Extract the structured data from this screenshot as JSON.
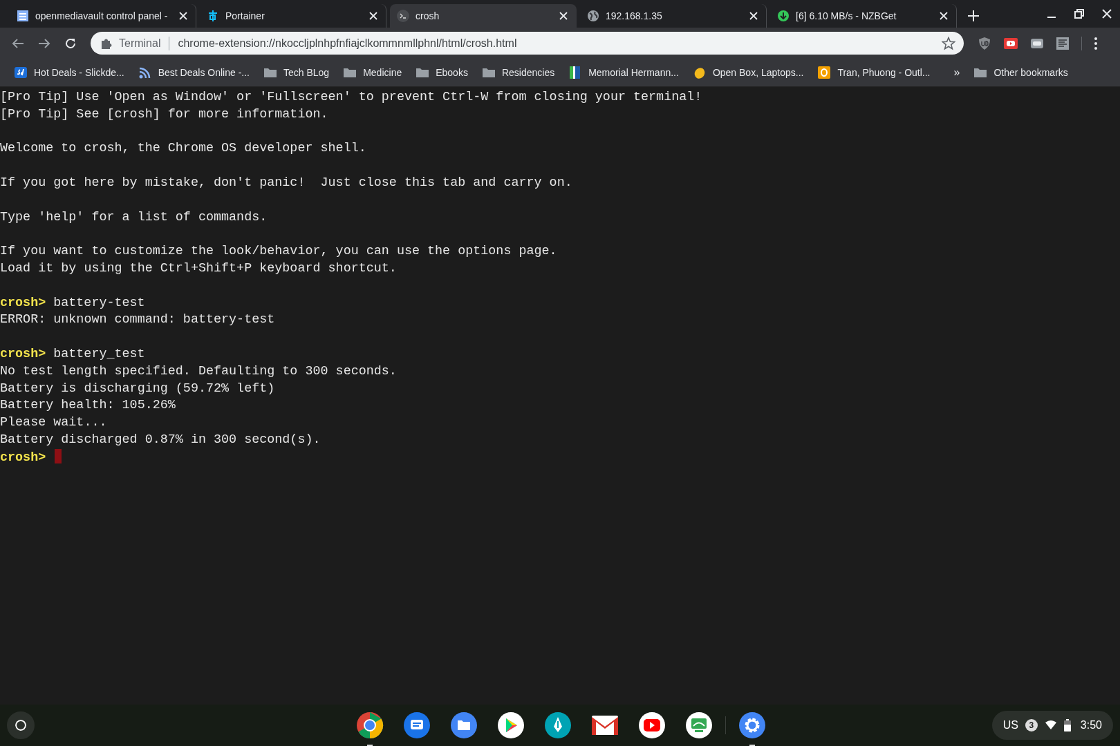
{
  "tabs": [
    {
      "title": "openmediavault control panel -",
      "selected": false
    },
    {
      "title": "Portainer",
      "selected": false
    },
    {
      "title": "crosh",
      "selected": true
    },
    {
      "title": "192.168.1.35",
      "selected": false
    },
    {
      "title": "[6] 6.10 MB/s - NZBGet",
      "selected": false
    }
  ],
  "omnibox": {
    "chip": "Terminal",
    "url": "chrome-extension://nkoccljplnhpfnfiajclkommnmllphnl/html/crosh.html"
  },
  "bookmarks": [
    {
      "title": "Hot Deals - Slickde..."
    },
    {
      "title": "Best Deals Online -..."
    },
    {
      "title": "Tech BLog"
    },
    {
      "title": "Medicine"
    },
    {
      "title": "Ebooks"
    },
    {
      "title": "Residencies"
    },
    {
      "title": "Memorial Hermann..."
    },
    {
      "title": "Open Box, Laptops..."
    },
    {
      "title": "Tran, Phuong - Outl..."
    }
  ],
  "bookmarks_overflow": "»",
  "other_bookmarks": "Other bookmarks",
  "terminal": {
    "blocks": [
      [
        {
          "text": "[Pro Tip] Use 'Open as Window' or 'Fullscreen' to prevent Ctrl-W from closing your terminal!"
        },
        {
          "text": "[Pro Tip] See [crosh] for more information."
        }
      ],
      [
        {
          "text": "Welcome to crosh, the Chrome OS developer shell."
        }
      ],
      [
        {
          "text": "If you got here by mistake, don't panic!  Just close this tab and carry on."
        }
      ],
      [
        {
          "text": "Type 'help' for a list of commands."
        }
      ],
      [
        {
          "text": "If you want to customize the look/behavior, you can use the options page."
        },
        {
          "text": "Load it by using the Ctrl+Shift+P keyboard shortcut."
        }
      ],
      [
        {
          "prompt": "crosh>",
          "text": "battery-test"
        },
        {
          "text": "ERROR: unknown command: battery-test"
        }
      ],
      [
        {
          "prompt": "crosh>",
          "text": "battery_test"
        },
        {
          "text": "No test length specified. Defaulting to 300 seconds."
        },
        {
          "text": "Battery is discharging (59.72% left)"
        },
        {
          "text": "Battery health: 105.26%"
        },
        {
          "text": "Please wait..."
        },
        {
          "text": "Battery discharged 0.87% in 300 second(s)."
        },
        {
          "prompt": "crosh>",
          "cursor": true
        }
      ]
    ]
  },
  "shelf": {
    "apps": [
      {
        "running": true
      },
      {
        "running": false
      },
      {
        "running": false
      },
      {
        "running": false
      },
      {
        "running": false
      },
      {
        "running": false
      },
      {
        "running": false
      },
      {
        "running": false
      },
      {
        "running": true
      }
    ],
    "status": {
      "keyboard": "US",
      "notifications": "3",
      "time": "3:50"
    }
  }
}
